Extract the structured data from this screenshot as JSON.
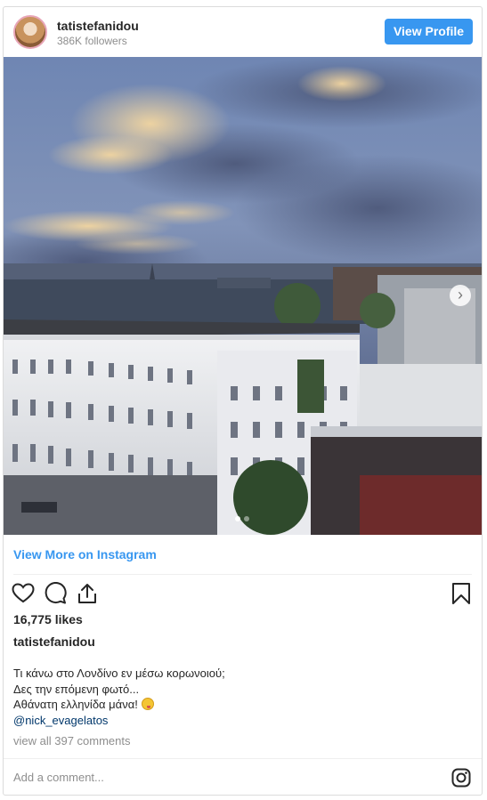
{
  "header": {
    "username": "tatistefanidou",
    "followers": "386K followers",
    "view_profile_label": "View Profile"
  },
  "photo": {
    "carousel_total": 2,
    "carousel_active": 1
  },
  "view_more_label": "View More on Instagram",
  "actions": {
    "like_icon": "heart-icon",
    "comment_icon": "comment-icon",
    "share_icon": "share-icon",
    "save_icon": "bookmark-icon"
  },
  "likes": "16,775 likes",
  "caption": {
    "username": "tatistefanidou",
    "lines": [
      "Τι κάνω στο Λονδίνο εν μέσω κορωνοιού;",
      "Δες την επόμενη φωτό...",
      "Αθάνατη ελληνίδα μάνα!"
    ],
    "mention": "@nick_evagelatos"
  },
  "view_comments": "view all 397 comments",
  "add_comment_placeholder": "Add a comment...",
  "colors": {
    "accent": "#3897f0",
    "text": "#262626",
    "muted": "#8e8e8e"
  }
}
